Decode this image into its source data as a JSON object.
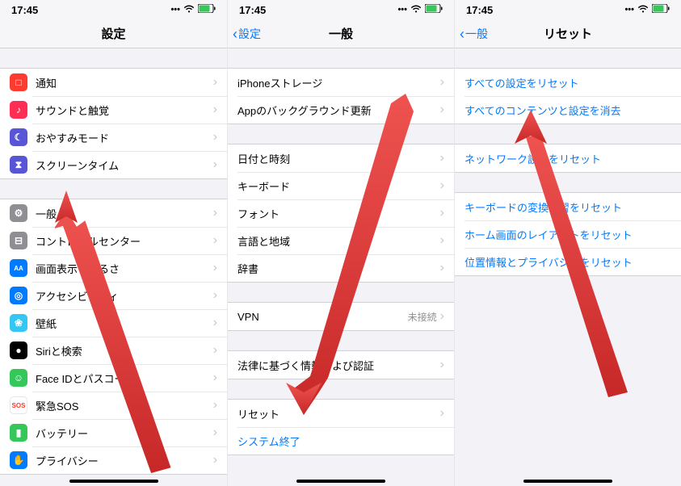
{
  "status": {
    "time": "17:45",
    "signal": "…",
    "wifi": "􀙇",
    "battery": "􀛨"
  },
  "phones": {
    "settings": {
      "title": "設定",
      "groups": [
        [
          {
            "key": "notifications",
            "label": "通知",
            "icon_bg": "#ff3b30",
            "glyph": "□"
          },
          {
            "key": "sounds",
            "label": "サウンドと触覚",
            "icon_bg": "#ff2d55",
            "glyph": "♪"
          },
          {
            "key": "dnd",
            "label": "おやすみモード",
            "icon_bg": "#5856d6",
            "glyph": "☾"
          },
          {
            "key": "screentime",
            "label": "スクリーンタイム",
            "icon_bg": "#5856d6",
            "glyph": "⧗"
          }
        ],
        [
          {
            "key": "general",
            "label": "一般",
            "icon_bg": "#8e8e93",
            "glyph": "⚙"
          },
          {
            "key": "control",
            "label": "コントロールセンター",
            "icon_bg": "#8e8e93",
            "glyph": "⊟"
          },
          {
            "key": "display",
            "label": "画面表示と明るさ",
            "icon_bg": "#007aff",
            "glyph": "AA"
          },
          {
            "key": "accessibility",
            "label": "アクセシビリティ",
            "icon_bg": "#007aff",
            "glyph": "◎"
          },
          {
            "key": "wallpaper",
            "label": "壁紙",
            "icon_bg": "#34c7f4",
            "glyph": "❀"
          },
          {
            "key": "siri",
            "label": "Siriと検索",
            "icon_bg": "#000000",
            "glyph": "●"
          },
          {
            "key": "faceid",
            "label": "Face IDとパスコード",
            "icon_bg": "#34c759",
            "glyph": "☺"
          },
          {
            "key": "sos",
            "label": "緊急SOS",
            "icon_bg": "#ffffff",
            "glyph": "SOS",
            "glyph_color": "#ff3b30"
          },
          {
            "key": "battery",
            "label": "バッテリー",
            "icon_bg": "#34c759",
            "glyph": "▮"
          },
          {
            "key": "privacy",
            "label": "プライバシー",
            "icon_bg": "#007aff",
            "glyph": "✋"
          }
        ]
      ]
    },
    "general": {
      "back": "設定",
      "title": "一般",
      "groups": [
        [
          {
            "key": "storage",
            "label": "iPhoneストレージ"
          },
          {
            "key": "bgrefresh",
            "label": "Appのバックグラウンド更新"
          }
        ],
        [
          {
            "key": "datetime",
            "label": "日付と時刻"
          },
          {
            "key": "keyboard",
            "label": "キーボード"
          },
          {
            "key": "font",
            "label": "フォント"
          },
          {
            "key": "language",
            "label": "言語と地域"
          },
          {
            "key": "dictionary",
            "label": "辞書"
          }
        ],
        [
          {
            "key": "vpn",
            "label": "VPN",
            "value": "未接続"
          }
        ],
        [
          {
            "key": "legal",
            "label": "法律に基づく情報および認証"
          }
        ],
        [
          {
            "key": "reset",
            "label": "リセット"
          },
          {
            "key": "shutdown",
            "label": "システム終了",
            "link": true,
            "no_chevron": true
          }
        ]
      ]
    },
    "reset": {
      "back": "一般",
      "title": "リセット",
      "groups": [
        [
          {
            "key": "reset_all",
            "label": "すべての設定をリセット",
            "link": true,
            "no_chevron": true
          },
          {
            "key": "erase_all",
            "label": "すべてのコンテンツと設定を消去",
            "link": true,
            "no_chevron": true
          }
        ],
        [
          {
            "key": "reset_network",
            "label": "ネットワーク設定をリセット",
            "link": true,
            "no_chevron": true
          }
        ],
        [
          {
            "key": "reset_kbd",
            "label": "キーボードの変換学習をリセット",
            "link": true,
            "no_chevron": true
          },
          {
            "key": "reset_home",
            "label": "ホーム画面のレイアウトをリセット",
            "link": true,
            "no_chevron": true
          },
          {
            "key": "reset_loc",
            "label": "位置情報とプライバシーをリセット",
            "link": true,
            "no_chevron": true
          }
        ]
      ]
    }
  }
}
